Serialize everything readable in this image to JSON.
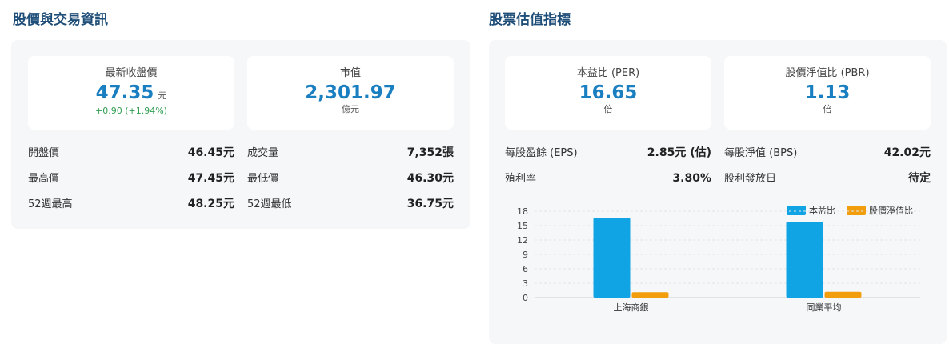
{
  "left": {
    "title": "股價與交易資訊",
    "cards": {
      "price": {
        "label": "最新收盤價",
        "value": "47.35",
        "unit": "元",
        "change": "+0.90 (+1.94%)"
      },
      "market_cap": {
        "label": "市值",
        "value": "2,301.97",
        "unit": "億元"
      }
    },
    "rows": {
      "open": {
        "label": "開盤價",
        "value": "46.45元"
      },
      "volume": {
        "label": "成交量",
        "value": "7,352張"
      },
      "high": {
        "label": "最高價",
        "value": "47.45元"
      },
      "low": {
        "label": "最低價",
        "value": "46.30元"
      },
      "high52": {
        "label": "52週最高",
        "value": "48.25元"
      },
      "low52": {
        "label": "52週最低",
        "value": "36.75元"
      }
    }
  },
  "right": {
    "title": "股票估值指標",
    "cards": {
      "per": {
        "label": "本益比 (PER)",
        "value": "16.65",
        "unit": "倍"
      },
      "pbr": {
        "label": "股價淨值比 (PBR)",
        "value": "1.13",
        "unit": "倍"
      }
    },
    "rows": {
      "eps": {
        "label": "每股盈餘 (EPS)",
        "value": "2.85元 (估)"
      },
      "bps": {
        "label": "每股淨值 (BPS)",
        "value": "42.02元"
      },
      "yield": {
        "label": "殖利率",
        "value": "3.80%"
      },
      "dividend_date": {
        "label": "股利發放日",
        "value": "待定"
      }
    }
  },
  "chart_data": {
    "type": "bar",
    "categories": [
      "上海商銀",
      "同業平均"
    ],
    "series": [
      {
        "name": "本益比",
        "values": [
          16.65,
          15.8
        ],
        "color": "#10a4e4"
      },
      {
        "name": "股價淨值比",
        "values": [
          1.13,
          1.2
        ],
        "color": "#f29e0c"
      }
    ],
    "yticks": [
      "0",
      "3",
      "6",
      "9",
      "12",
      "15",
      "18"
    ],
    "ylim": [
      0,
      18
    ],
    "grid": true,
    "legend": "top-right"
  }
}
